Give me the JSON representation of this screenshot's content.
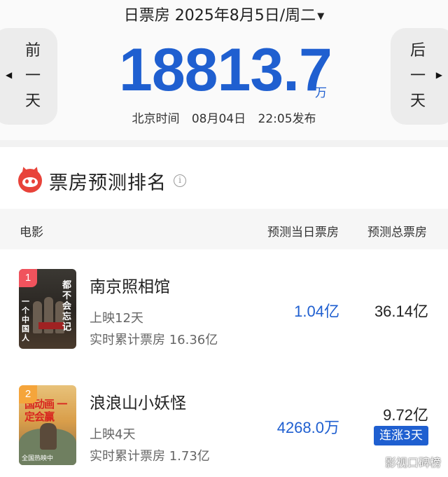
{
  "header": {
    "date_title": "日票房 2025年8月5日/周二",
    "caret_icon": "caret-down-icon",
    "prev_day_label": [
      "前",
      "一",
      "天"
    ],
    "next_day_label": [
      "后",
      "一",
      "天"
    ],
    "prev_icon": "triangle-left-icon",
    "next_icon": "triangle-right-icon",
    "box_office_total": "18813.7",
    "box_office_unit": "万",
    "publish_city": "北京时间",
    "publish_date": "08月04日",
    "publish_time": "22:05发布"
  },
  "ranking": {
    "title": "票房预测排名",
    "logo_icon": "maoyan-cat-logo-icon",
    "info_icon": "info-icon",
    "columns": {
      "movie": "电影",
      "day_forecast": "预测当日票房",
      "total_forecast": "预测总票房"
    },
    "movies": [
      {
        "rank": "1",
        "name": "南京照相馆",
        "days": "上映12天",
        "cumulative": "实时累计票房 16.36亿",
        "day_forecast": "1.04亿",
        "total_forecast": "36.14亿",
        "poster_text_right": "都不会忘记",
        "poster_text_left": "一个中国人"
      },
      {
        "rank": "2",
        "name": "浪浪山小妖怪",
        "days": "上映4天",
        "cumulative": "实时累计票房 1.73亿",
        "day_forecast": "4268.0万",
        "total_forecast": "9.72亿",
        "trend": "连涨3天",
        "poster_text": "国动画 一定会赢",
        "poster_caption": "全国热映中"
      }
    ]
  },
  "watermark": "影视口碑榜",
  "colors": {
    "accent_blue": "#1f5fd0",
    "rank1": "#f0535d",
    "rank2": "#f5a53b",
    "logo_red": "#e8433a"
  }
}
